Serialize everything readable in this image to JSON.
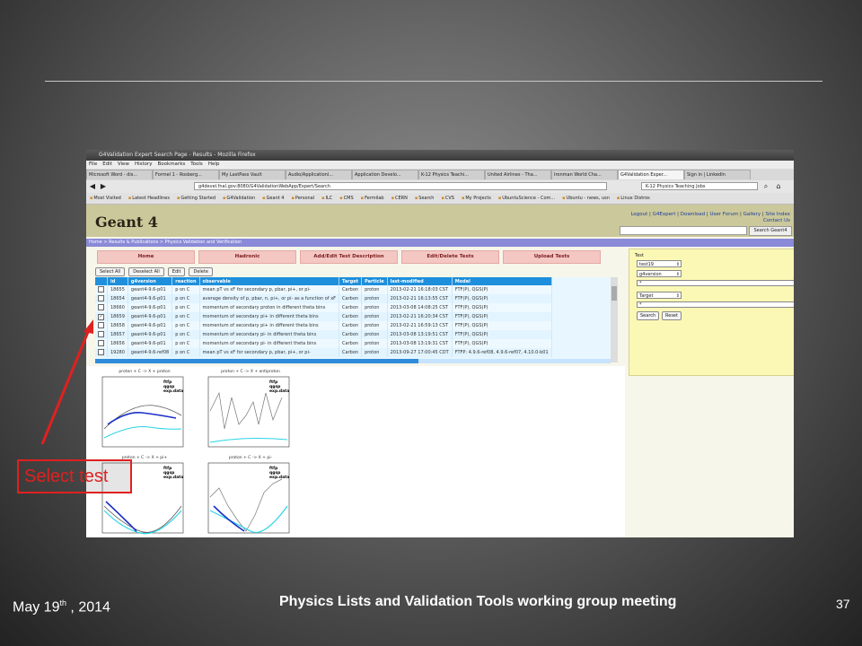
{
  "browser": {
    "window_title": "G4Validation Expert Search Page - Results - Mozilla Firefox",
    "menu": [
      "File",
      "Edit",
      "View",
      "History",
      "Bookmarks",
      "Tools",
      "Help"
    ],
    "tabs": [
      "Microsoft Word - dis...",
      "Formel 1 - Rosberg...",
      "My LastPass Vault",
      "Audio/Applicationl...",
      "Application Develo...",
      "K-12 Physics Teachi...",
      "United Airlines - Tha...",
      "Ironman World Cha...",
      "G4Validation Exper...",
      "Sign in | LinkedIn"
    ],
    "url": "g4devel.fnal.gov:8080/G4ValidationWebApp/Expert/Search",
    "search": "K-12 Physics Teaching Jobs",
    "bookmarks": [
      "Most Visited",
      "Latest Headlines",
      "Getting Started",
      "G4Validation",
      "Geant 4",
      "Personal",
      "ILC",
      "CMS",
      "Fermilab",
      "CERN",
      "Search",
      "CVS",
      "My Projects",
      "UbuntuScience - Com...",
      "Ubuntu - news, usn",
      "Linux Distros"
    ]
  },
  "site": {
    "logo": "Geant 4",
    "links_line1": [
      "Logout",
      "G4Expert",
      "Download",
      "User Forum",
      "Gallery",
      "Site Index"
    ],
    "links_line2": "Contact Us",
    "search_button": "Search Geant4",
    "breadcrumb": "Home > Results & Publications > Physics Validation and Verification",
    "nav": [
      "Home",
      "Hadronic",
      "Add/Edit Test Description",
      "Edit/Delete Tests",
      "Upload Tests"
    ],
    "actions": [
      "Select All",
      "Deselect All",
      "Edit",
      "Delete"
    ]
  },
  "table": {
    "headers": [
      "",
      "id",
      "g4version",
      "reaction",
      "observable",
      "Target",
      "Particle",
      "last-modified",
      "Model"
    ],
    "rows": [
      {
        "checked": false,
        "id": "18655",
        "g4version": "geant4-9.6-p01",
        "reaction": "p on C",
        "observable": "mean pT vs xF for secondary p, pbar, pi+, or pi-",
        "target": "Carbon",
        "particle": "proton",
        "modified": "2013-02-21 16:18:03 CST",
        "model": "FTF(P), QGS(P)"
      },
      {
        "checked": false,
        "id": "18654",
        "g4version": "geant4-9.6-p01",
        "reaction": "p on C",
        "observable": "average density of p, pbar, n, pi+, or pi- as a function of xF",
        "target": "Carbon",
        "particle": "proton",
        "modified": "2013-02-21 16:13:55 CST",
        "model": "FTF(P), QGS(P)"
      },
      {
        "checked": false,
        "id": "18660",
        "g4version": "geant4-9.6-p01",
        "reaction": "p on C",
        "observable": "momentum of secondary proton in different theta bins",
        "target": "Carbon",
        "particle": "proton",
        "modified": "2013-03-08 14:08:25 CST",
        "model": "FTF(P), QGS(P)"
      },
      {
        "checked": true,
        "id": "18659",
        "g4version": "geant4-9.6-p01",
        "reaction": "p on C",
        "observable": "momentum of secondary pi+ in different theta bins",
        "target": "Carbon",
        "particle": "proton",
        "modified": "2013-02-21 16:20:34 CST",
        "model": "FTF(P), QGS(P)"
      },
      {
        "checked": false,
        "id": "18658",
        "g4version": "geant4-9.6-p01",
        "reaction": "p on C",
        "observable": "momentum of secondary pi+ in different theta bins",
        "target": "Carbon",
        "particle": "proton",
        "modified": "2013-02-21 16:59:13 CST",
        "model": "FTF(P), QGS(P)"
      },
      {
        "checked": false,
        "id": "18657",
        "g4version": "geant4-9.6-p01",
        "reaction": "p on C",
        "observable": "momentum of secondary pi- in different theta bins",
        "target": "Carbon",
        "particle": "proton",
        "modified": "2013-03-08 13:19:51 CST",
        "model": "FTF(P), QGS(P)"
      },
      {
        "checked": false,
        "id": "18656",
        "g4version": "geant4-9.6-p01",
        "reaction": "p on C",
        "observable": "momentum of secondary pi- in different theta bins",
        "target": "Carbon",
        "particle": "proton",
        "modified": "2013-03-08 13:19:31 CST",
        "model": "FTF(P), QGS(P)"
      },
      {
        "checked": false,
        "id": "19280",
        "g4version": "geant4-9.6-ref08",
        "reaction": "p on C",
        "observable": "mean pT vs xF for secondary p, pbar, pi+, or pi-",
        "target": "Carbon",
        "particle": "proton",
        "modified": "2013-09-27 17:00:45 CDT",
        "model": "FTFP: 4.9.6-ref08, 4.9.6-ref07, 4.10.0-b01"
      }
    ]
  },
  "panel": {
    "label": "Test",
    "select1": "test19",
    "select2": "g4version",
    "input1": "*",
    "select3": "Target",
    "input2": "*",
    "search_button": "Search",
    "reset_button": "Reset"
  },
  "plots": [
    {
      "title": "proton + C -> X + proton",
      "legend": [
        "ftfp",
        "qgsp",
        "exp.data"
      ]
    },
    {
      "title": "proton + C -> X + antiproton",
      "legend": [
        "ftfp",
        "qgsp",
        "exp.data"
      ]
    },
    {
      "title": "proton + C -> X + pi+",
      "legend": [
        "ftfp",
        "qgsp",
        "exp.data"
      ]
    },
    {
      "title": "proton + C -> X + pi-",
      "legend": [
        "ftfp",
        "qgsp",
        "exp.data"
      ]
    }
  ],
  "callout": "Select test",
  "footer": {
    "date_main": "May 19",
    "date_sup": "th",
    "date_rest": " , 2014",
    "title": "Physics Lists and Validation Tools working group meeting",
    "page": "37"
  },
  "colors": {
    "accent": "#e02020",
    "header_blue": "#1e8fdc",
    "nav_pink": "#f4c7c3",
    "panel_yellow": "#fbf8b6"
  }
}
